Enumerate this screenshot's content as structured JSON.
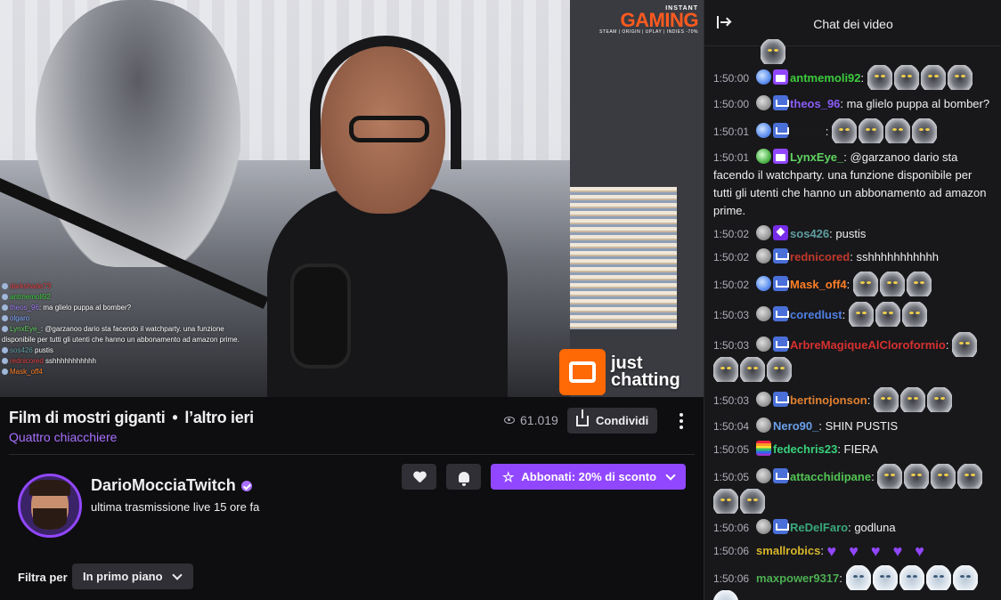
{
  "video": {
    "brand_top": "INSTANT",
    "brand_main": "GAMING",
    "brand_sub": "STEAM | ORIGIN | UPLAY | INDIES -70%",
    "category_logo_line1": "just",
    "category_logo_line2": "chatting",
    "overlay_chat": [
      {
        "user": "darkshade73",
        "text": ""
      },
      {
        "user": "antmemoli92",
        "text": ""
      },
      {
        "user": "theos_96",
        "text": "ma glielo puppa al bomber?"
      },
      {
        "user": "olgaro",
        "text": ""
      },
      {
        "user": "LynxEye_",
        "text": "@garzanoo dario sta facendo il watchparty. una funzione"
      },
      {
        "user": "",
        "text": "disponibile per tutti gli utenti che hanno un abbonamento ad amazon prime."
      },
      {
        "user": "sos426",
        "text": "pustis"
      },
      {
        "user": "rednicored",
        "text": "sshhhhhhhhhhh"
      },
      {
        "user": "Mask_off4",
        "text": ""
      }
    ]
  },
  "info": {
    "title": "Film di mostri giganti",
    "separator": "•",
    "time_ago": "l’altro ieri",
    "category": "Quattro chiacchiere",
    "views": "61.019",
    "share_label": "Condividi",
    "channel_name": "DarioMocciaTwitch",
    "last_live": "ultima trasmissione live 15 ore fa",
    "subscribe_label": "Abbonati: 20% di sconto",
    "filter_label": "Filtra per",
    "filter_value": "In primo piano"
  },
  "chat": {
    "title": "Chat dei video",
    "messages": [
      {
        "ts": "1:50:00",
        "user": "antmemoli92",
        "color": "#3ccc3c",
        "text": ""
      },
      {
        "ts": "1:50:00",
        "user": "theos_96",
        "color": "#8a5cf5",
        "text": "ma glielo puppa al bomber?"
      },
      {
        "ts": "1:50:01",
        "user": "olgaro",
        "color": "#1a1a1a",
        "text": ""
      },
      {
        "ts": "1:50:01",
        "user": "LynxEye_",
        "color": "#5fd35f",
        "text": "@garzanoo dario sta facendo il watchparty. una funzione disponibile per tutti gli utenti che hanno un abbonamento ad amazon prime."
      },
      {
        "ts": "1:50:02",
        "user": "sos426",
        "color": "#5f9ea0",
        "text": "pustis"
      },
      {
        "ts": "1:50:02",
        "user": "rednicored",
        "color": "#c0392b",
        "text": "sshhhhhhhhhhh"
      },
      {
        "ts": "1:50:02",
        "user": "Mask_off4",
        "color": "#ff7f24",
        "text": ""
      },
      {
        "ts": "1:50:03",
        "user": "coredlust",
        "color": "#4f7fe0",
        "text": ""
      },
      {
        "ts": "1:50:03",
        "user": "ArbreMagiqueAlCloroformio",
        "color": "#d63030",
        "text": ""
      },
      {
        "ts": "1:50:03",
        "user": "bertinojonson",
        "color": "#e08030",
        "text": ""
      },
      {
        "ts": "1:50:04",
        "user": "Nero90_",
        "color": "#6aa0e8",
        "text": "SHIN PUSTIS"
      },
      {
        "ts": "1:50:05",
        "user": "fedechris23",
        "color": "#38d07a",
        "text": "FIERA"
      },
      {
        "ts": "1:50:05",
        "user": "attacchidipane",
        "color": "#52c452",
        "text": ""
      },
      {
        "ts": "1:50:06",
        "user": "ReDelFaro",
        "color": "#3aa87a",
        "text": "godluna"
      },
      {
        "ts": "1:50:06",
        "user": "smallrobics",
        "color": "#d6b52a",
        "text": ""
      },
      {
        "ts": "1:50:06",
        "user": "maxpower9317",
        "color": "#4caf50",
        "text": ""
      }
    ]
  }
}
